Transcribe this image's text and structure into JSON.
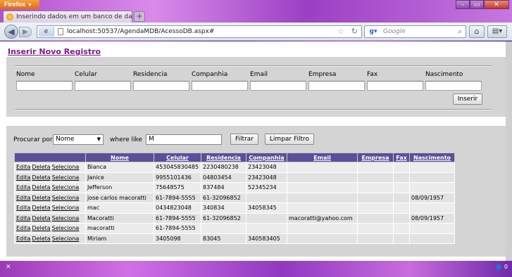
{
  "browser": {
    "menu_label": "Firefox",
    "tab_title": "Inserindo dados em um banco de dados...",
    "url": "localhost:50537/AgendaMDB/AcessoDB.aspx#",
    "search_placeholder": "Google",
    "status_count": "0"
  },
  "form": {
    "heading": "Inserir Novo Registro",
    "fields": [
      "Nome",
      "Celular",
      "Residencia",
      "Companhia",
      "Email",
      "Empresa",
      "Fax",
      "Nascimento"
    ],
    "submit_label": "Inserir"
  },
  "filter": {
    "procurar_label": "Procurar por",
    "field_selected": "Nome",
    "where_label": "where like",
    "value": "M",
    "filter_button": "Filtrar",
    "clear_button": "Limpar Filtro"
  },
  "grid": {
    "action_labels": [
      "Edita",
      "Deleta",
      "Seleciona"
    ],
    "columns": [
      "Nome",
      "Celular",
      "Residencia",
      "Companhia",
      "Email",
      "Empresa",
      "Fax",
      "Nascimento"
    ],
    "rows": [
      [
        "Bianca",
        "453045830485",
        "2230480238",
        "23423048",
        "",
        "",
        "",
        ""
      ],
      [
        "Janice",
        "9955101436",
        "04803454",
        "23423048",
        "",
        "",
        "",
        ""
      ],
      [
        "Jefferson",
        "75648575",
        "837484",
        "52345234",
        "",
        "",
        "",
        ""
      ],
      [
        "jose carlos macoratti",
        "61-7894-5555",
        "61-32096852",
        "",
        "",
        "",
        "",
        "08/09/1957"
      ],
      [
        "mac",
        "0434823048",
        "340834",
        "34058345",
        "",
        "",
        "",
        ""
      ],
      [
        "Macoratti",
        "61-7894-5555",
        "61-32096852",
        "",
        "macoratti@yahoo.com",
        "",
        "",
        "08/09/1957"
      ],
      [
        "macoratti",
        "61-7894-5555",
        "",
        "",
        "",
        "",
        "",
        ""
      ],
      [
        "Miriam",
        "3405098",
        "83045",
        "340583405",
        "",
        "",
        "",
        ""
      ]
    ]
  }
}
